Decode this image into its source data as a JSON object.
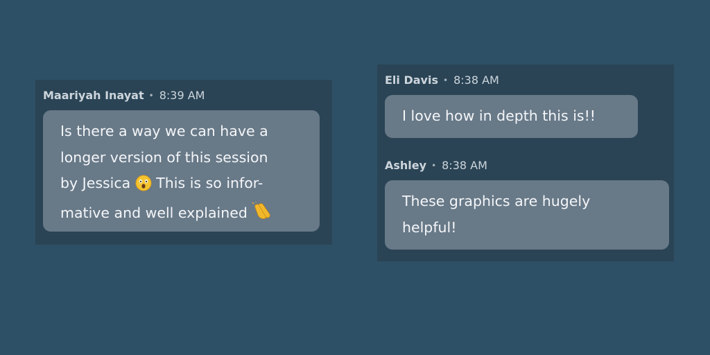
{
  "messages": [
    {
      "author": "Maariyah Inayat",
      "separator": "•",
      "time": "8:39 AM",
      "lines": [
        "Is there a way we can have a",
        "longer version of this session",
        "by Jessica",
        "This is so infor-",
        "mative and well explained"
      ],
      "emojis": [
        "astonished-face-icon",
        "clapping-hands-icon"
      ]
    },
    {
      "author": "Eli Davis",
      "separator": "•",
      "time": "8:38 AM",
      "lines": [
        "I love how in depth this is!!"
      ]
    },
    {
      "author": "Ashley",
      "separator": "•",
      "time": "8:38 AM",
      "lines": [
        "These graphics are hugely",
        "helpful!"
      ]
    }
  ],
  "colors": {
    "background": "#2e5066",
    "panel": "#2a4455",
    "bubble": "#687988",
    "message_text": "#f4f6f8",
    "meta_text": "#cdd5dc"
  }
}
